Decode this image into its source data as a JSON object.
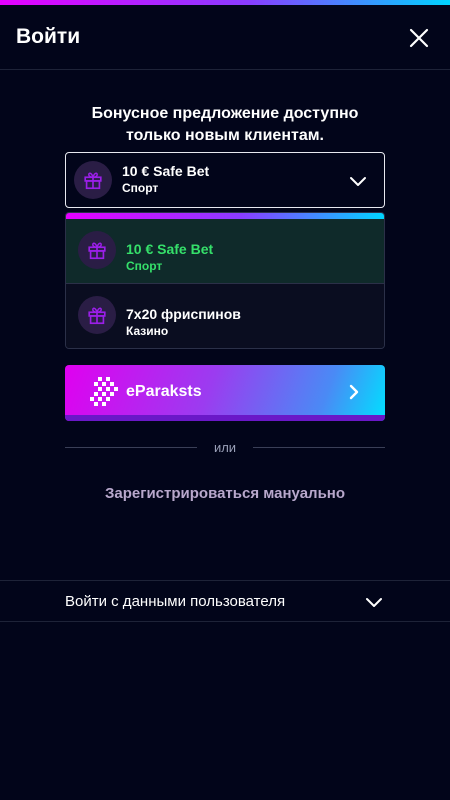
{
  "header": {
    "title": "Войти",
    "close_icon": "close-icon"
  },
  "offer": {
    "line1": "Бонусное предложение доступно",
    "line2": "только новым клиентам."
  },
  "bonus_select": {
    "selected_title": "10 € Safe Bet",
    "selected_subtitle": "Спорт",
    "icon": "gift-icon",
    "chevron": "chevron-down-icon"
  },
  "dropdown": {
    "options": [
      {
        "title": "10 € Safe Bet",
        "subtitle": "Спорт",
        "selected": true,
        "icon": "gift-icon"
      },
      {
        "title": "7x20 фриспинов",
        "subtitle": "Казино",
        "selected": false,
        "icon": "gift-icon"
      }
    ]
  },
  "eparaksts": {
    "label": "eParaksts",
    "icon": "eparaksts-logo-icon",
    "arrow": "chevron-right-icon"
  },
  "divider": {
    "text": "или"
  },
  "manual_register": {
    "label": "Зарегистрироваться мануально"
  },
  "login_credentials": {
    "label": "Войти с данными пользователя",
    "chevron": "chevron-down-icon"
  },
  "colors": {
    "background": "#02051a",
    "accent_magenta": "#e500ff",
    "accent_cyan": "#00d4ff",
    "selected_green": "#35e06a",
    "gift_purple": "#9b1fe8",
    "link_muted": "#b8a8cc"
  }
}
